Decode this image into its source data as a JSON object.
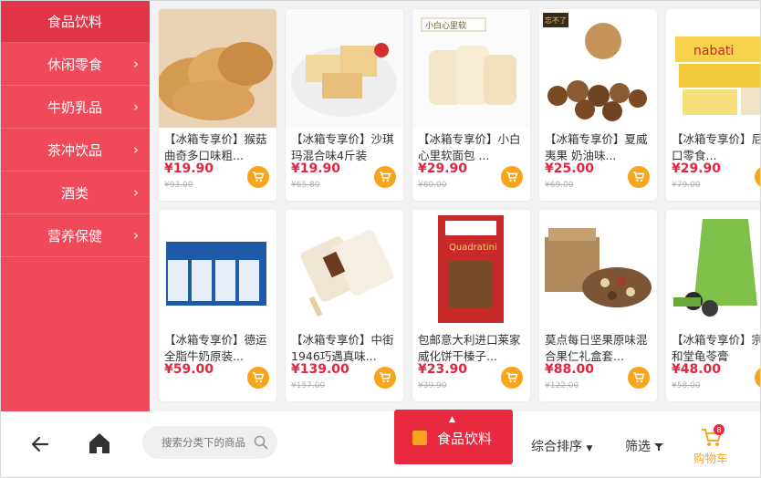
{
  "sidebar": {
    "items": [
      {
        "label": "食品饮料",
        "active": true
      },
      {
        "label": "休闲零食"
      },
      {
        "label": "牛奶乳品"
      },
      {
        "label": "茶冲饮品"
      },
      {
        "label": "酒类"
      },
      {
        "label": "营养保健"
      }
    ]
  },
  "products": [
    {
      "title": "【冰箱专享价】猴菇曲奇多口味粗...",
      "price": "¥19.90",
      "old": "¥93.00"
    },
    {
      "title": "【冰箱专享价】沙琪玛混合味4斤装",
      "price": "¥19.90",
      "old": "¥65.80"
    },
    {
      "title": "【冰箱专享价】小白心里软面包 ...",
      "price": "¥29.90",
      "old": "¥80.00"
    },
    {
      "title": "【冰箱专享价】夏威夷果 奶油味...",
      "price": "¥25.00",
      "old": "¥69.00"
    },
    {
      "title": "【冰箱专享价】尼进口零食...",
      "price": "¥29.90",
      "old": "¥79.00"
    },
    {
      "title": "【冰箱专享价】德运全脂牛奶原装...",
      "price": "¥59.00",
      "old": ""
    },
    {
      "title": "【冰箱专享价】中街1946巧遇真味...",
      "price": "¥139.00",
      "old": "¥157.00"
    },
    {
      "title": "包邮意大利进口莱家威化饼干榛子...",
      "price": "¥23.90",
      "old": "¥39.90"
    },
    {
      "title": "莫点每日坚果原味混合果仁礼盒套...",
      "price": "¥88.00",
      "old": "¥122.00"
    },
    {
      "title": "【冰箱专享价】宗生和堂龟苓膏",
      "price": "¥48.00",
      "old": "¥58.00"
    }
  ],
  "image_text": {
    "p3": "小白心里软",
    "p4": "忘不了",
    "p5": "nabati",
    "p8": "Quadratini"
  },
  "bottom": {
    "search_placeholder": "搜索分类下的商品",
    "category_label": "食品饮料",
    "sort_label": "综合排序",
    "filter_label": "筛选",
    "cart_label": "购物车",
    "cart_badge": "8"
  },
  "colors": {
    "sidebar": "#f04a5a",
    "sidebar_active": "#e23447",
    "price": "#e5243f",
    "cart_button": "#f7a51c",
    "category_button": "#e8293f"
  }
}
